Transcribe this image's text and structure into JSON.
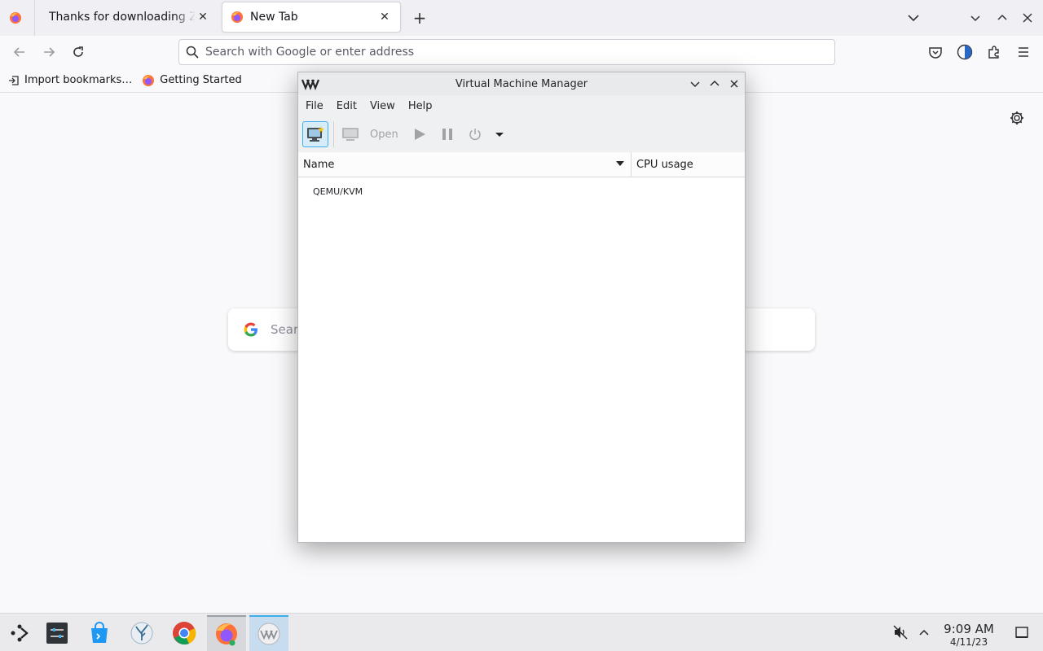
{
  "browser": {
    "tabs": [
      {
        "title": "Thanks for downloading Zoom",
        "close": "✕"
      },
      {
        "title": "New Tab",
        "close": "✕"
      }
    ],
    "new_tab_symbol": "+",
    "urlbar": {
      "placeholder": "Search with Google or enter address"
    },
    "bookmarks": [
      {
        "label": "Import bookmarks…",
        "icon": "import-icon"
      },
      {
        "label": "Getting Started",
        "icon": "firefox-icon"
      }
    ],
    "newtab_search": {
      "placeholder": "Sear"
    }
  },
  "vmm": {
    "title": "Virtual Machine Manager",
    "menu": [
      "File",
      "Edit",
      "View",
      "Help"
    ],
    "toolbar": {
      "open_label": "Open"
    },
    "columns": {
      "name": "Name",
      "cpu": "CPU usage"
    },
    "connections": [
      "QEMU/KVM"
    ]
  },
  "taskbar": {
    "clock": {
      "time": "9:09 AM",
      "date": "4/11/23"
    }
  },
  "colors": {
    "accent": "#3daee9",
    "firefox_orange": "#ff7139"
  }
}
